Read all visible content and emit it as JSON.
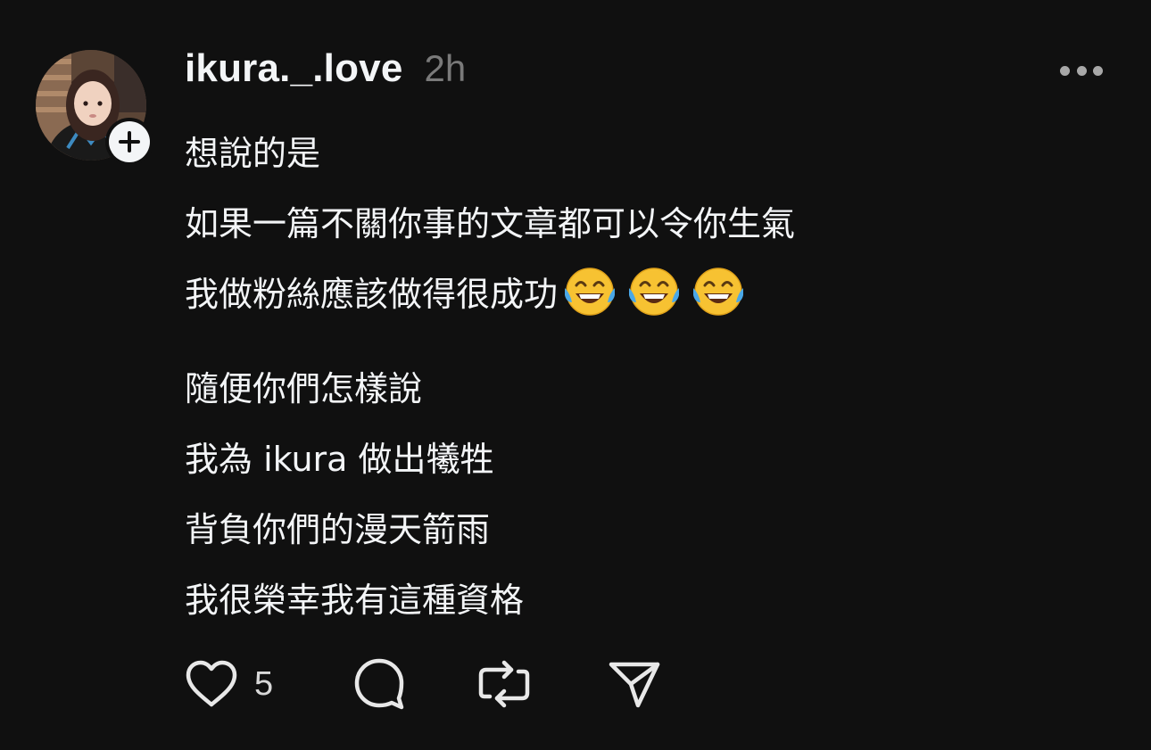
{
  "post": {
    "author": {
      "username": "ikura._.love",
      "timestamp": "2h",
      "avatar_icon": "profile-photo",
      "follow_icon": "plus-icon"
    },
    "menu_icon": "more-horizontal-icon",
    "lines": {
      "line1": "想說的是",
      "line2": "如果一篇不關你事的文章都可以令你生氣",
      "line3": "我做粉絲應該做得很成功",
      "line3_emojis": [
        "face-with-tears-of-joy",
        "face-with-tears-of-joy",
        "face-with-tears-of-joy"
      ],
      "line4": "隨便你們怎樣說",
      "line5": "我為 ikura 做出犧牲",
      "line6": "背負你們的漫天箭雨",
      "line7": "我很榮幸我有這種資格"
    },
    "actions": {
      "like_icon": "heart-icon",
      "like_count": "5",
      "comment_icon": "comment-icon",
      "repost_icon": "repost-icon",
      "share_icon": "send-icon"
    }
  },
  "colors": {
    "background": "#101010",
    "text_primary": "#f3f5f7",
    "text_secondary": "#7a7a7a",
    "icon": "#e8e8e8"
  }
}
